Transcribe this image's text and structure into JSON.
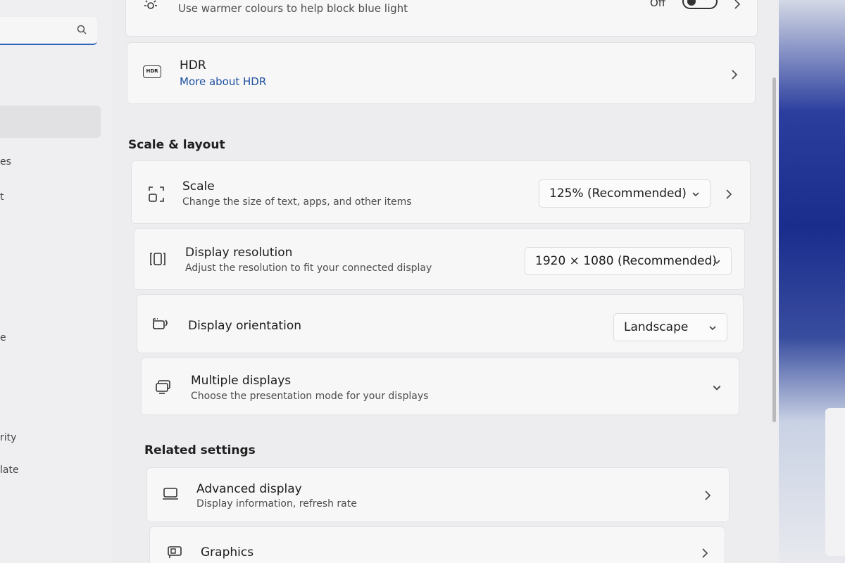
{
  "sidebar": {
    "search_placeholder": "",
    "fragments": [
      "es",
      "t",
      "e",
      "rity",
      "late"
    ]
  },
  "night_light": {
    "subtitle": "Use warmer colours to help block blue light",
    "toggle_label": "Off",
    "toggle_on": false
  },
  "hdr": {
    "icon_label": "HDR",
    "title": "HDR",
    "link": "More about HDR"
  },
  "scale_layout": {
    "heading": "Scale & layout",
    "scale": {
      "title": "Scale",
      "subtitle": "Change the size of text, apps, and other items",
      "value": "125% (Recommended)"
    },
    "resolution": {
      "title": "Display resolution",
      "subtitle": "Adjust the resolution to fit your connected display",
      "value": "1920 × 1080 (Recommended)"
    },
    "orientation": {
      "title": "Display orientation",
      "value": "Landscape"
    },
    "multiple": {
      "title": "Multiple displays",
      "subtitle": "Choose the presentation mode for your displays"
    }
  },
  "related": {
    "heading": "Related settings",
    "advanced": {
      "title": "Advanced display",
      "subtitle": "Display information, refresh rate"
    },
    "graphics": {
      "title": "Graphics"
    }
  },
  "icons": {
    "search": "search-icon",
    "brightness": "sun-icon",
    "hdr": "hdr-icon",
    "scale": "scale-icon",
    "resolution": "resolution-icon",
    "orientation": "orientation-icon",
    "multiple": "multiple-displays-icon",
    "advanced": "monitor-icon",
    "graphics": "graphics-card-icon",
    "chevron_right": "chevron-right-icon",
    "chevron_down": "chevron-down-icon"
  },
  "colors": {
    "accent": "#2b63b8",
    "link": "#1d4f9e"
  }
}
